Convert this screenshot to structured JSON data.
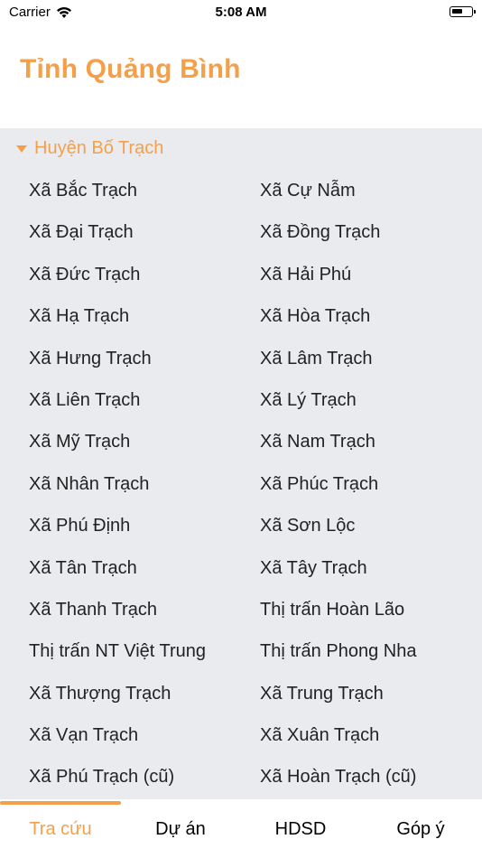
{
  "status_bar": {
    "carrier": "Carrier",
    "time": "5:08 AM"
  },
  "header": {
    "title": "Tỉnh Quảng Bình"
  },
  "group": {
    "name": "Huyện Bố Trạch",
    "items": [
      "Xã Bắc Trạch",
      "Xã Cự Nẫm",
      "Xã Đại Trạch",
      "Xã Đồng Trạch",
      "Xã Đức Trạch",
      "Xã Hải Phú",
      "Xã Hạ Trạch",
      "Xã Hòa Trạch",
      "Xã Hưng Trạch",
      "Xã Lâm Trạch",
      "Xã Liên Trạch",
      "Xã Lý Trạch",
      "Xã Mỹ Trạch",
      "Xã Nam Trạch",
      "Xã Nhân Trạch",
      "Xã Phúc Trạch",
      "Xã Phú Định",
      "Xã Sơn Lộc",
      "Xã Tân Trạch",
      "Xã Tây Trạch",
      "Xã Thanh Trạch",
      "Thị trấn Hoàn Lão",
      "Thị trấn NT Việt Trung",
      "Thị trấn Phong Nha",
      "Xã Thượng Trạch",
      "Xã Trung Trạch",
      "Xã Vạn Trạch",
      "Xã Xuân Trạch",
      "Xã Phú Trạch (cũ)",
      "Xã Hoàn Trạch (cũ)"
    ]
  },
  "tabs": [
    {
      "label": "Tra cứu",
      "active": true
    },
    {
      "label": "Dự án",
      "active": false
    },
    {
      "label": "HDSD",
      "active": false
    },
    {
      "label": "Góp ý",
      "active": false
    }
  ],
  "colors": {
    "accent": "#f4a04a",
    "content_bg": "#e9ebee"
  },
  "icons": [
    "wifi-icon",
    "battery-icon",
    "disclosure-triangle-icon"
  ]
}
